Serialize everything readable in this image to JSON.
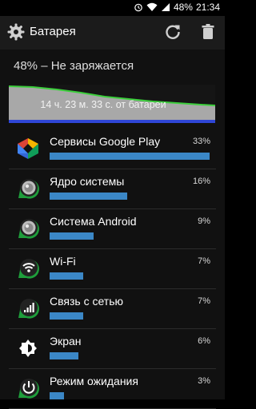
{
  "status_bar": {
    "battery_percent": "48%",
    "time": "21:34"
  },
  "app_bar": {
    "title": "Батарея"
  },
  "battery": {
    "status_text": "48% – Не заряжается",
    "time_left": "14 ч. 23 м. 33 с. от батареи"
  },
  "usage": [
    {
      "label": "Сервисы Google Play",
      "percent": "33%",
      "value": 33,
      "icon": "google-play-services-icon"
    },
    {
      "label": "Ядро системы",
      "percent": "16%",
      "value": 16,
      "icon": "system-kernel-icon"
    },
    {
      "label": "Система Android",
      "percent": "9%",
      "value": 9,
      "icon": "android-system-icon"
    },
    {
      "label": "Wi-Fi",
      "percent": "7%",
      "value": 7,
      "icon": "wifi-icon"
    },
    {
      "label": "Связь с сетью",
      "percent": "7%",
      "value": 7,
      "icon": "cell-signal-icon"
    },
    {
      "label": "Экран",
      "percent": "6%",
      "value": 6,
      "icon": "brightness-icon"
    },
    {
      "label": "Режим ожидания",
      "percent": "3%",
      "value": 3,
      "icon": "power-icon"
    }
  ],
  "colors": {
    "bar": "#3b87c6",
    "graph_line": "#3ccf3c",
    "graph_baseline": "#2f46d6"
  }
}
